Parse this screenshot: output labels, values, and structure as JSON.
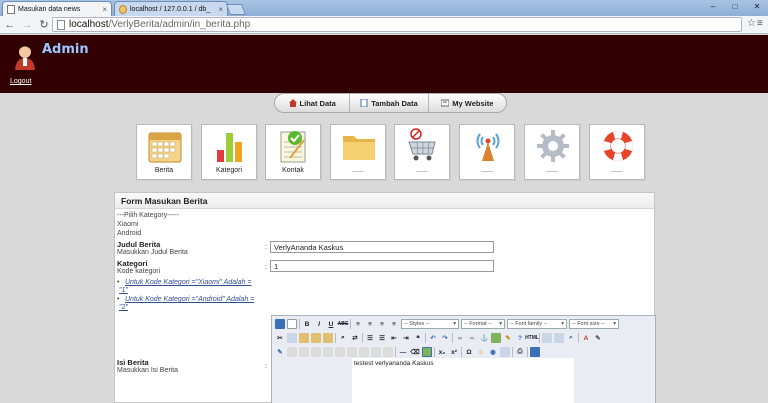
{
  "browser": {
    "tabs": [
      {
        "label": "Masukan data news",
        "active": true
      },
      {
        "label": "localhost / 127.0.0.1 / db_",
        "active": false
      }
    ],
    "url_host": "localhost",
    "url_path": "/VerlyBerita/admin/in_berita.php"
  },
  "header": {
    "title": "Admin",
    "logout": "Logout",
    "bg_color": "#320002",
    "title_color": "#9cc6ff"
  },
  "nav": [
    {
      "label": "Lihat Data",
      "icon": "home-icon"
    },
    {
      "label": "Tambah Data",
      "icon": "document-icon"
    },
    {
      "label": "My Website",
      "icon": "page-icon"
    }
  ],
  "tiles": [
    {
      "label": "Berita",
      "icon": "calendar-icon"
    },
    {
      "label": "Kategori",
      "icon": "bar-chart-icon"
    },
    {
      "label": "Kontak",
      "icon": "notepad-check-icon"
    },
    {
      "label": "......",
      "icon": "folder-icon"
    },
    {
      "label": "......",
      "icon": "cart-icon"
    },
    {
      "label": "......",
      "icon": "wifi-tower-icon"
    },
    {
      "label": "......",
      "icon": "gear-icon"
    },
    {
      "label": "......",
      "icon": "lifebuoy-icon"
    }
  ],
  "form": {
    "title": "Form Masukan Berita",
    "category_header": "---Pilih Kategory-----",
    "categories": [
      "Xiaomi",
      "Android"
    ],
    "judul_label": "Judul Berita",
    "judul_sub": "Masukkan Judul Berita",
    "judul_value": "VerlyAnanda Kaskus",
    "kategori_label": "Kategori",
    "kategori_sub": "Kode kategori",
    "kategori_value": "1",
    "hints": [
      "Untuk Kode Kategori =\"Xiaomi\" Adalah =",
      "\"1\"",
      "Untuk Kode Kategori =\"Android\" Adalah =",
      "\"2\""
    ],
    "isi_label": "Isi Berita",
    "isi_sub": "Masukkan Isi Berita",
    "colon": ":",
    "editor_text": "testest verlyananda Kaskus"
  },
  "editor_toolbar": {
    "styles": "-- Styles --",
    "format": "-- Format --",
    "font_family": "-- Font family --",
    "font_size": "-- Font size --"
  }
}
